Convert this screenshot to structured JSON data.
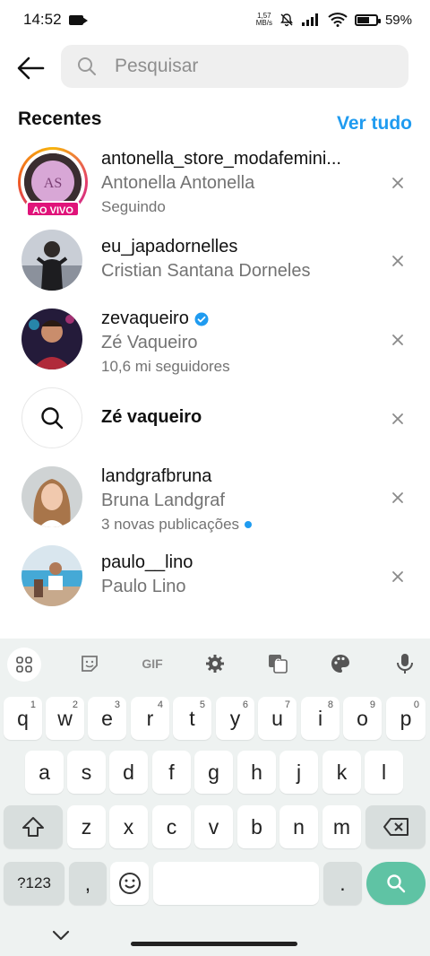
{
  "status_bar": {
    "time": "14:52",
    "net_speed_value": "1,57",
    "net_speed_unit": "MB/s",
    "battery": "59%"
  },
  "search": {
    "placeholder": "Pesquisar"
  },
  "recent_header": {
    "title": "Recentes",
    "see_all": "Ver tudo"
  },
  "recents": [
    {
      "username": "antonella_store_modafemini...",
      "fullname": "Antonella Antonella",
      "subtitle": "Seguindo",
      "live_badge": "AO VIVO",
      "logo_text": "AS"
    },
    {
      "username": "eu_japadornelles",
      "fullname": "Cristian Santana Dorneles"
    },
    {
      "username": "zevaqueiro",
      "fullname": "Zé Vaqueiro",
      "subtitle": "10,6 mi seguidores",
      "verified": true
    },
    {
      "query": "Zé vaqueiro"
    },
    {
      "username": "landgrafbruna",
      "fullname": "Bruna Landgraf",
      "subtitle": "3 novas publicações"
    },
    {
      "username": "paulo__lino",
      "fullname": "Paulo Lino"
    }
  ],
  "keyboard": {
    "toolbar": {
      "gif": "GIF"
    },
    "row1": [
      {
        "k": "q",
        "h": "1"
      },
      {
        "k": "w",
        "h": "2"
      },
      {
        "k": "e",
        "h": "3"
      },
      {
        "k": "r",
        "h": "4"
      },
      {
        "k": "t",
        "h": "5"
      },
      {
        "k": "y",
        "h": "6"
      },
      {
        "k": "u",
        "h": "7"
      },
      {
        "k": "i",
        "h": "8"
      },
      {
        "k": "o",
        "h": "9"
      },
      {
        "k": "p",
        "h": "0"
      }
    ],
    "row2": [
      "a",
      "s",
      "d",
      "f",
      "g",
      "h",
      "j",
      "k",
      "l"
    ],
    "row3": [
      "z",
      "x",
      "c",
      "v",
      "b",
      "n",
      "m"
    ],
    "symbols": "?123",
    "comma": ",",
    "period": "."
  },
  "colors": {
    "accent": "#1f9bf0",
    "live": "#e0137a",
    "enter_key": "#5fc3a4"
  }
}
